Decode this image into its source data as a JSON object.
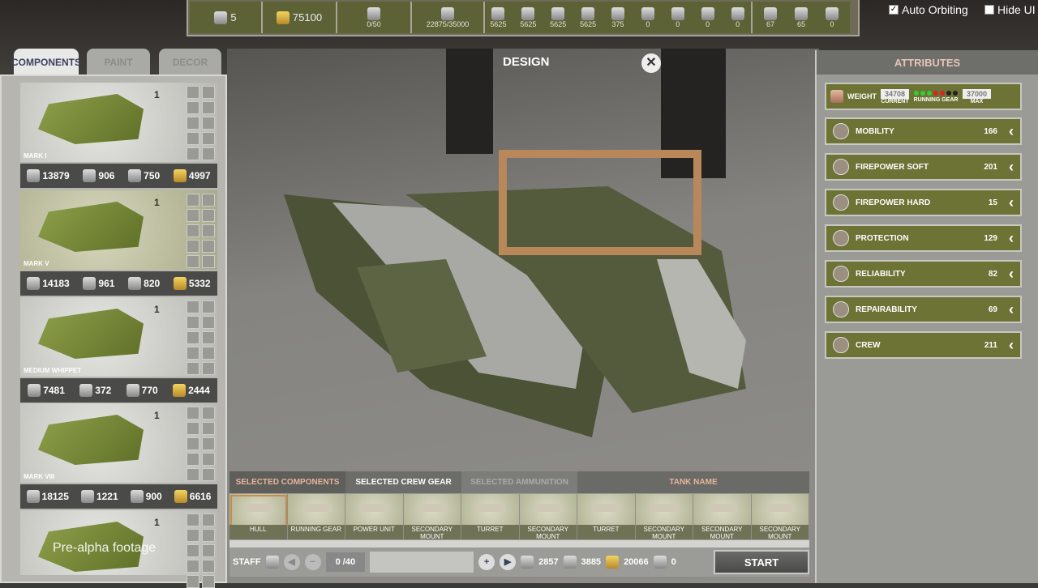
{
  "topbar": {
    "rank": "5",
    "money": "75100",
    "slots": "0/50",
    "storage": "22875/35000",
    "resources": [
      "5625",
      "5625",
      "5625",
      "5625",
      "375",
      "0",
      "0",
      "0",
      "0"
    ],
    "crew": [
      "67",
      "65",
      "0"
    ]
  },
  "options": {
    "auto_orbiting": "Auto Orbiting",
    "hide_ui": "Hide UI"
  },
  "left_tabs": [
    "COMPONENTS",
    "PAINT",
    "DECOR"
  ],
  "components": [
    {
      "name": "MARK I",
      "crew": "1",
      "weight": "13879",
      "steel": "906",
      "parts": "750",
      "cost": "4997"
    },
    {
      "name": "MARK V",
      "crew": "1",
      "weight": "14183",
      "steel": "961",
      "parts": "820",
      "cost": "5332"
    },
    {
      "name": "MEDIUM WHIPPET",
      "crew": "1",
      "weight": "7481",
      "steel": "372",
      "parts": "770",
      "cost": "2444"
    },
    {
      "name": "MARK VIII",
      "crew": "1",
      "weight": "18125",
      "steel": "1221",
      "parts": "900",
      "cost": "6616"
    },
    {
      "name": "",
      "crew": "1"
    }
  ],
  "design": {
    "title": "DESIGN",
    "close": "✕"
  },
  "attributes": {
    "title": "ATTRIBUTES",
    "weight": {
      "label": "WEIGHT",
      "current": "34708",
      "current_label": "CURRENT",
      "gear_label": "RUNNING GEAR",
      "max": "37000",
      "max_label": "MAX"
    },
    "items": [
      {
        "label": "MOBILITY",
        "value": "166"
      },
      {
        "label": "FIREPOWER SOFT",
        "value": "201"
      },
      {
        "label": "FIREPOWER HARD",
        "value": "15"
      },
      {
        "label": "PROTECTION",
        "value": "129"
      },
      {
        "label": "RELIABILITY",
        "value": "82"
      },
      {
        "label": "REPAIRABILITY",
        "value": "69"
      },
      {
        "label": "CREW",
        "value": "211"
      }
    ]
  },
  "bottom": {
    "tabs": [
      "SELECTED COMPONENTS",
      "SELECTED CREW GEAR",
      "SELECTED AMMUNITION",
      "TANK NAME"
    ],
    "slots": [
      "HULL",
      "RUNNING GEAR",
      "POWER UNIT",
      "SECONDARY MOUNT",
      "TURRET",
      "SECONDARY MOUNT",
      "TURRET",
      "SECONDARY MOUNT",
      "SECONDARY MOUNT",
      "SECONDARY MOUNT"
    ],
    "staff_label": "STAFF",
    "staff_count": "0 /40",
    "steel": "2857",
    "parts": "3885",
    "cost": "20066",
    "days": "0",
    "start": "START"
  },
  "watermark": "Pre-alpha footage"
}
